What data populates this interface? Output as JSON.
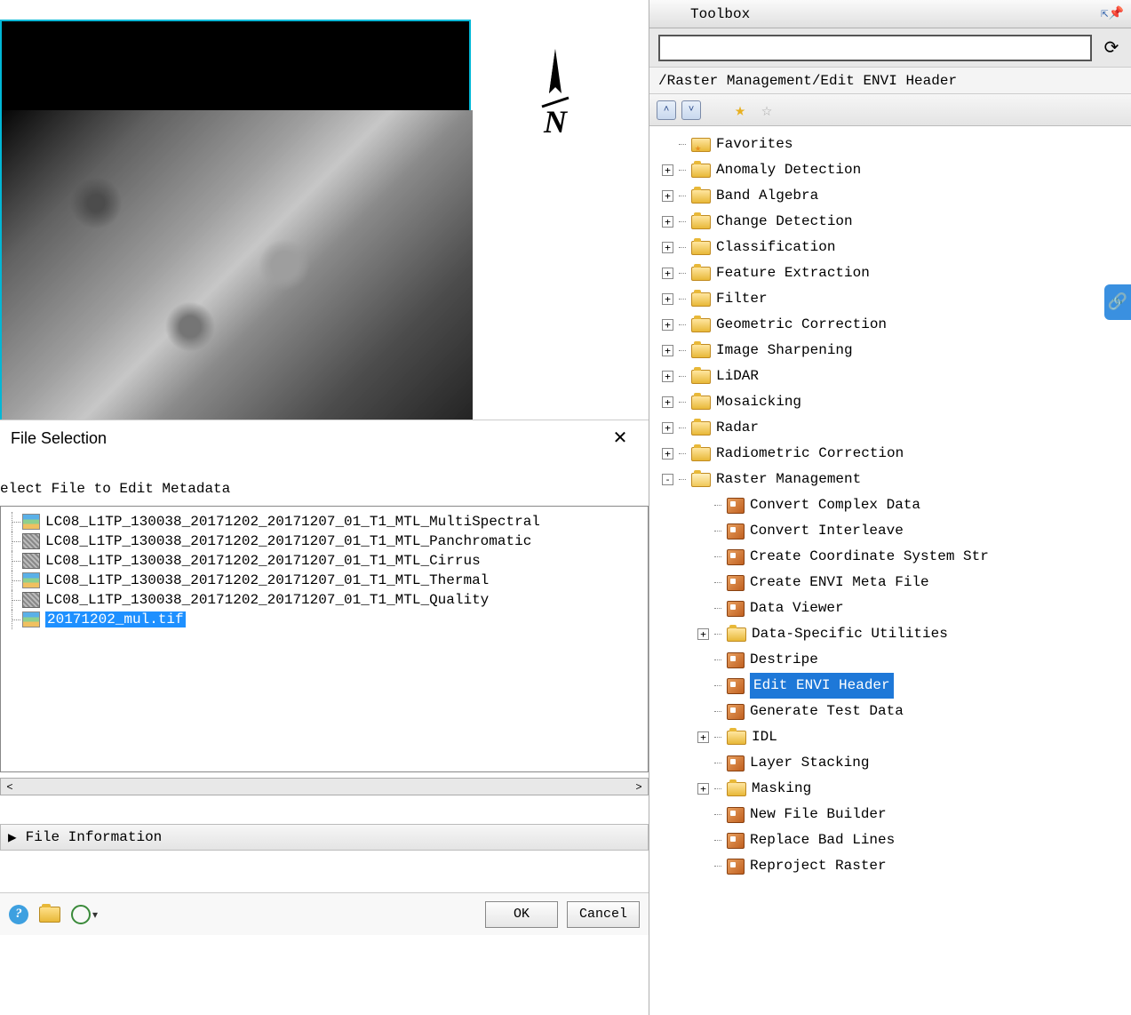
{
  "toolbox": {
    "title": "Toolbox",
    "breadcrumb": "/Raster Management/Edit ENVI Header",
    "search_placeholder": "",
    "folders": [
      {
        "label": "Favorites",
        "type": "fav",
        "exp": ""
      },
      {
        "label": "Anomaly Detection",
        "type": "folder",
        "exp": "+"
      },
      {
        "label": "Band Algebra",
        "type": "folder",
        "exp": "+"
      },
      {
        "label": "Change Detection",
        "type": "folder",
        "exp": "+"
      },
      {
        "label": "Classification",
        "type": "folder",
        "exp": "+"
      },
      {
        "label": "Feature Extraction",
        "type": "folder",
        "exp": "+"
      },
      {
        "label": "Filter",
        "type": "folder",
        "exp": "+"
      },
      {
        "label": "Geometric Correction",
        "type": "folder",
        "exp": "+"
      },
      {
        "label": "Image Sharpening",
        "type": "folder",
        "exp": "+"
      },
      {
        "label": "LiDAR",
        "type": "folder",
        "exp": "+"
      },
      {
        "label": "Mosaicking",
        "type": "folder",
        "exp": "+"
      },
      {
        "label": "Radar",
        "type": "folder",
        "exp": "+"
      },
      {
        "label": "Radiometric Correction",
        "type": "folder",
        "exp": "+"
      },
      {
        "label": "Raster Management",
        "type": "folder-open",
        "exp": "-"
      }
    ],
    "raster_tools": [
      {
        "label": "Convert Complex Data",
        "type": "tool",
        "exp": ""
      },
      {
        "label": "Convert Interleave",
        "type": "tool",
        "exp": ""
      },
      {
        "label": "Create Coordinate System Str",
        "type": "tool",
        "exp": ""
      },
      {
        "label": "Create ENVI Meta File",
        "type": "tool",
        "exp": ""
      },
      {
        "label": "Data Viewer",
        "type": "tool",
        "exp": ""
      },
      {
        "label": "Data-Specific Utilities",
        "type": "folder",
        "exp": "+"
      },
      {
        "label": "Destripe",
        "type": "tool",
        "exp": ""
      },
      {
        "label": "Edit ENVI Header",
        "type": "tool",
        "exp": "",
        "selected": true
      },
      {
        "label": "Generate Test Data",
        "type": "tool",
        "exp": ""
      },
      {
        "label": "IDL",
        "type": "folder",
        "exp": "+"
      },
      {
        "label": "Layer Stacking",
        "type": "tool",
        "exp": ""
      },
      {
        "label": "Masking",
        "type": "folder",
        "exp": "+"
      },
      {
        "label": "New File Builder",
        "type": "tool",
        "exp": ""
      },
      {
        "label": "Replace Bad Lines",
        "type": "tool",
        "exp": ""
      },
      {
        "label": "Reproject Raster",
        "type": "tool",
        "exp": ""
      }
    ]
  },
  "dialog": {
    "title": "File Selection",
    "subtitle": "elect File to Edit Metadata",
    "file_info": "File Information",
    "ok": "OK",
    "cancel": "Cancel",
    "files": [
      {
        "name": "LC08_L1TP_130038_20171202_20171207_01_T1_MTL_MultiSpectral",
        "icon": "color"
      },
      {
        "name": "LC08_L1TP_130038_20171202_20171207_01_T1_MTL_Panchromatic",
        "icon": "gray"
      },
      {
        "name": "LC08_L1TP_130038_20171202_20171207_01_T1_MTL_Cirrus",
        "icon": "gray"
      },
      {
        "name": "LC08_L1TP_130038_20171202_20171207_01_T1_MTL_Thermal",
        "icon": "color"
      },
      {
        "name": "LC08_L1TP_130038_20171202_20171207_01_T1_MTL_Quality",
        "icon": "gray"
      },
      {
        "name": "20171202_mul.tif",
        "icon": "color",
        "selected": true
      }
    ]
  },
  "compass_label": "N"
}
